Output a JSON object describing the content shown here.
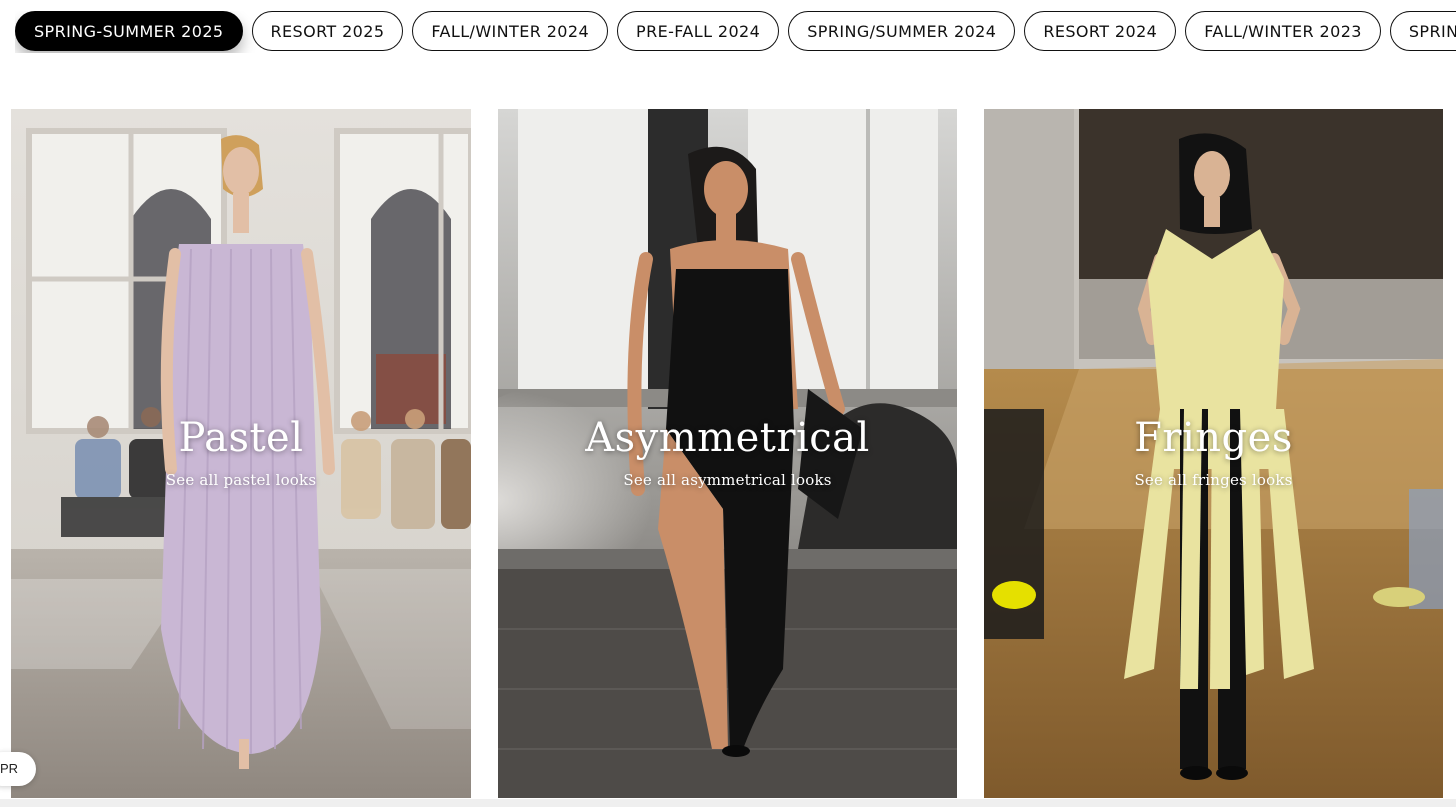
{
  "seasons": {
    "items": [
      {
        "label": "SPRING-SUMMER 2025",
        "active": true
      },
      {
        "label": "RESORT 2025",
        "active": false
      },
      {
        "label": "FALL/WINTER 2024",
        "active": false
      },
      {
        "label": "PRE-FALL 2024",
        "active": false
      },
      {
        "label": "SPRING/SUMMER 2024",
        "active": false
      },
      {
        "label": "RESORT 2024",
        "active": false
      },
      {
        "label": "FALL/WINTER 2023",
        "active": false
      },
      {
        "label": "SPRING/",
        "active": false
      }
    ]
  },
  "cards": [
    {
      "title": "Pastel",
      "link": "See all pastel looks",
      "dress_color": "#c9b7d4"
    },
    {
      "title": "Asymmetrical",
      "link": "See all asymmetrical looks",
      "dress_color": "#111111"
    },
    {
      "title": "Fringes",
      "link": "See all fringes looks",
      "dress_color": "#e9e3a0"
    }
  ],
  "chat_tab": {
    "label": "PR"
  },
  "colors": {
    "active_pill": "#000000",
    "text_overlay": "#ffffff"
  }
}
